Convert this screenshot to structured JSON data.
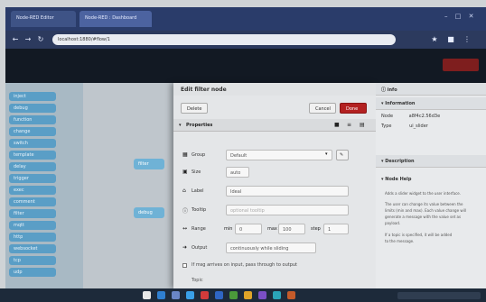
{
  "browser": {
    "tabs": [
      {
        "label": "Node-RED Editor"
      },
      {
        "label": "Node-RED : Dashboard"
      }
    ],
    "address": "localhost:1880/#flow/1"
  },
  "palette": {
    "nodes": [
      "inject",
      "debug",
      "function",
      "change",
      "switch",
      "template",
      "delay",
      "trigger",
      "exec",
      "comment",
      "filter",
      "mqtt",
      "http",
      "websocket",
      "tcp",
      "udp"
    ]
  },
  "workspace": {
    "nodes": [
      "filter",
      "debug"
    ]
  },
  "tray": {
    "title": "Edit filter node",
    "delete_label": "Delete",
    "cancel_label": "Cancel",
    "done_label": "Done",
    "properties_label": "Properties",
    "rows": {
      "group": {
        "label": "Group",
        "value": "Default"
      },
      "size": {
        "label": "Size",
        "value": "auto"
      },
      "label": {
        "label": "Label",
        "value": "Ideal"
      },
      "tooltip": {
        "label": "Tooltip",
        "placeholder": "optional tooltip"
      },
      "range": {
        "label": "Range",
        "min_label": "min",
        "min_value": "0",
        "max_label": "max",
        "max_value": "100",
        "step_label": "step",
        "step_value": "1"
      },
      "output": {
        "label": "Output",
        "value": "continuously while sliding"
      }
    },
    "passthrough_note": "If msg arrives on input, pass through to output",
    "topic_label": "Topic"
  },
  "sidebar": {
    "tab_label": "info",
    "info_header": "Information",
    "info_rows": [
      {
        "key": "Node",
        "value": "a8f4c2.56d3e"
      },
      {
        "key": "Type",
        "value": "ui_slider"
      }
    ],
    "description_header": "Description",
    "node_help_header": "Node Help",
    "help_lines": [
      "Adds a slider widget to the user interface.",
      "The user can change its value between the",
      "limits (min and max). Each value change will",
      "generate a message with the value set as",
      "payload.",
      "If a topic is specified, it will be added",
      "to the message."
    ]
  },
  "colors": {
    "accent": "#b32121",
    "header": "#121923",
    "node": "#5a9ec6"
  }
}
